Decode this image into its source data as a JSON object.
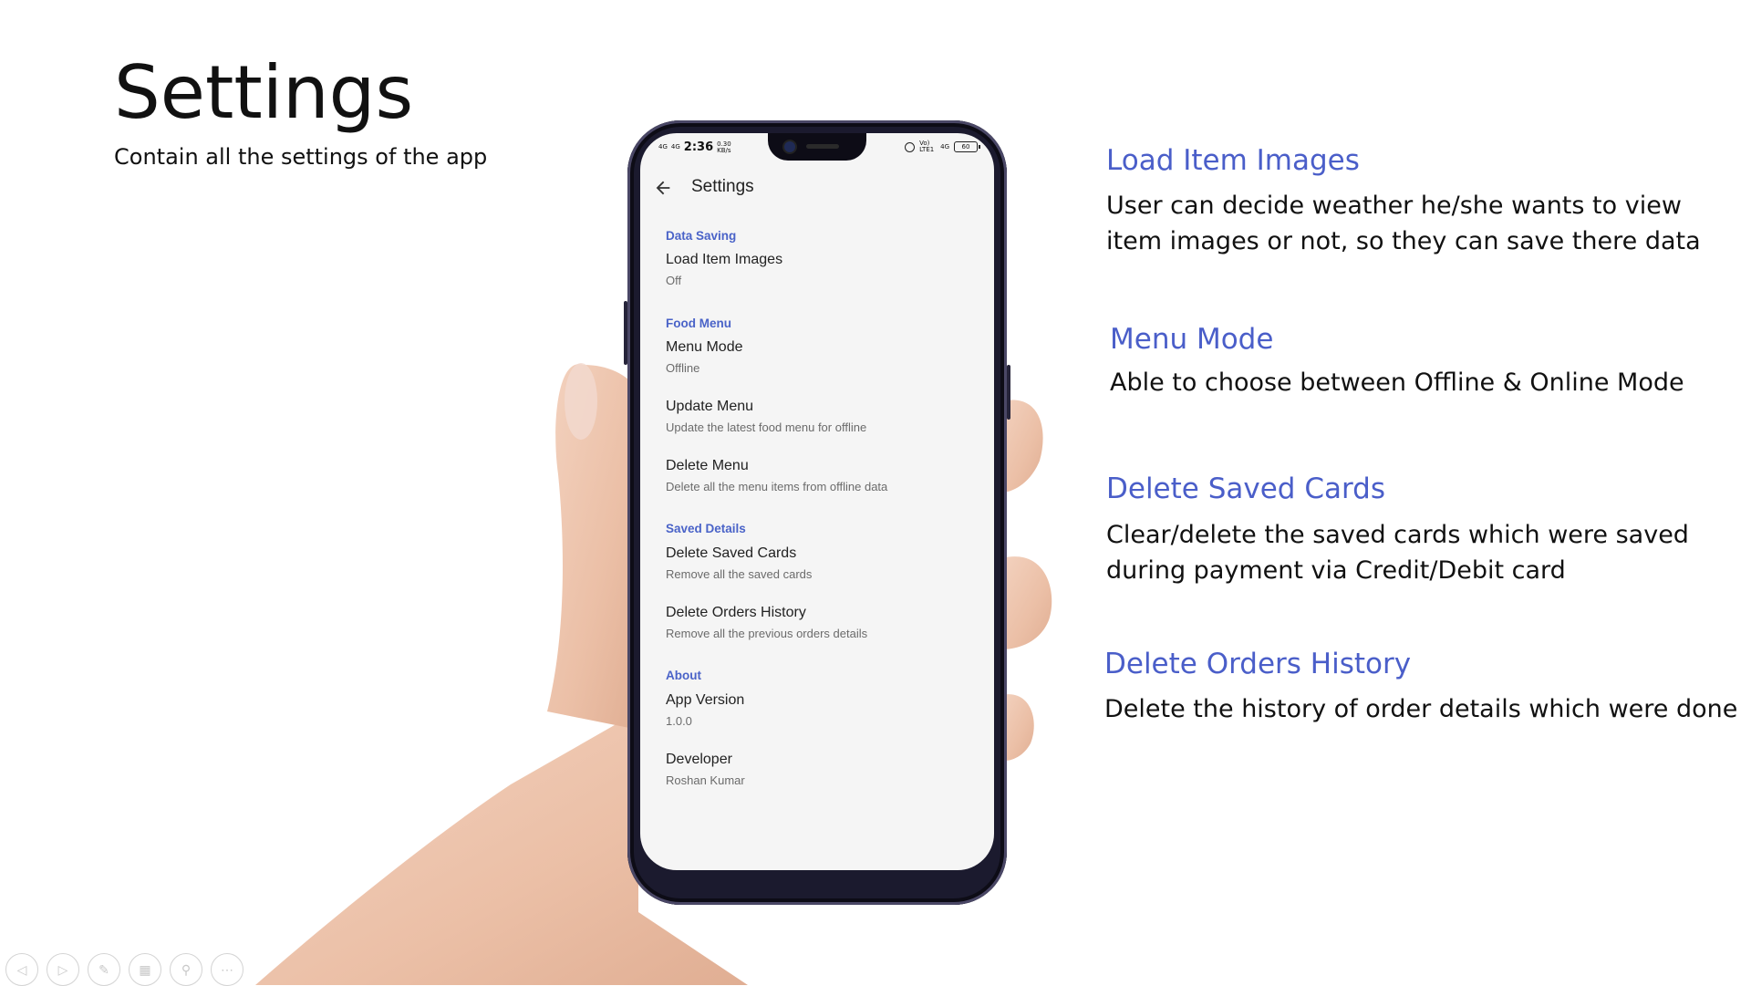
{
  "slide": {
    "title": "Settings",
    "subtitle": "Contain all the settings of the app"
  },
  "phone": {
    "status_bar": {
      "signal1": "4G",
      "signal2": "4G",
      "time": "2:36",
      "speed": "0.30 KB/s",
      "volte": "Vo) LTE1",
      "net": "4G",
      "battery": "60"
    },
    "app_bar": {
      "title": "Settings",
      "back_icon": "arrow-left-icon"
    },
    "sections": {
      "data_saving": "Data Saving",
      "food_menu": "Food Menu",
      "saved_details": "Saved Details",
      "about": "About"
    },
    "items": {
      "load_item_images": {
        "title": "Load Item Images",
        "summary": "Off"
      },
      "menu_mode": {
        "title": "Menu Mode",
        "summary": "Offline"
      },
      "update_menu": {
        "title": "Update Menu",
        "summary": "Update the latest food menu for offline"
      },
      "delete_menu": {
        "title": "Delete Menu",
        "summary": "Delete all the menu items from offline data"
      },
      "delete_saved_cards": {
        "title": "Delete Saved Cards",
        "summary": "Remove all the saved cards"
      },
      "delete_orders_history": {
        "title": "Delete Orders History",
        "summary": "Remove all the previous orders details"
      },
      "app_version": {
        "title": "App Version",
        "summary": "1.0.0"
      },
      "developer": {
        "title": "Developer",
        "summary": "Roshan Kumar"
      }
    },
    "accent_color": "#4a63c8"
  },
  "descriptions": {
    "load_images": {
      "heading": "Load Item Images",
      "line1": "User can decide weather he/she wants to view",
      "line2": "item images or not, so they can save there data"
    },
    "menu_mode": {
      "heading": "Menu Mode",
      "line1": "Able to choose between Offline & Online Mode"
    },
    "delete_cards": {
      "heading": "Delete Saved Cards",
      "line1": "Clear/delete the saved cards which were saved",
      "line2": "during payment via Credit/Debit card"
    },
    "delete_orders": {
      "heading": "Delete Orders History",
      "line1": "Delete the history of order details which were done"
    },
    "heading_color": "#4a5ec9"
  },
  "toolbar": {
    "icons": [
      "previous-icon",
      "next-icon",
      "pen-icon",
      "slides-icon",
      "zoom-icon",
      "more-icon"
    ]
  }
}
